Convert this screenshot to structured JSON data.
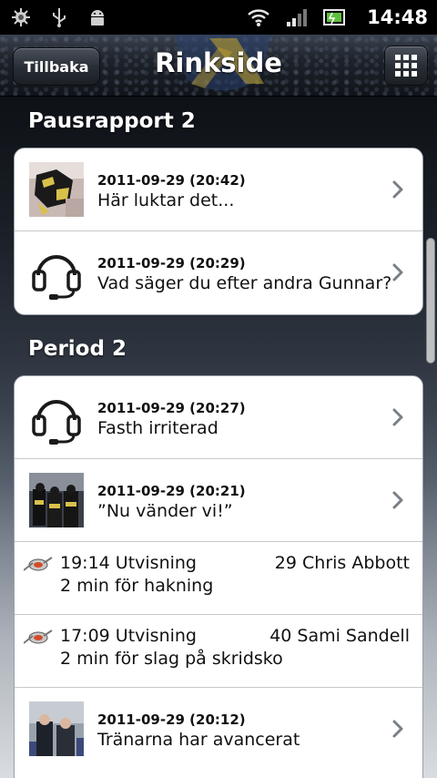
{
  "statusbar": {
    "time": "14:48",
    "icons": [
      "settings-chip-icon",
      "usb-icon",
      "android-icon",
      "wifi-icon",
      "signal-icon",
      "battery-icon"
    ]
  },
  "header": {
    "back_label": "Tillbaka",
    "title": "Rinkside",
    "menu_icon": "grid-icon"
  },
  "sections": [
    {
      "title": "Pausrapport 2",
      "items": [
        {
          "type": "photo",
          "date": "2011-09-29 (20:42)",
          "text": "Här luktar det..."
        },
        {
          "type": "audio",
          "date": "2011-09-29 (20:29)",
          "text": "Vad säger du efter andra Gunnar?"
        }
      ]
    },
    {
      "title": "Period 2",
      "items": [
        {
          "type": "audio",
          "date": "2011-09-29 (20:27)",
          "text": "Fasth irriterad"
        },
        {
          "type": "photo",
          "date": "2011-09-29 (20:21)",
          "text": "”Nu vänder vi!”"
        },
        {
          "type": "event",
          "time": "19:14 Utvisning",
          "player": "29 Chris Abbott",
          "detail": "2 min för hakning"
        },
        {
          "type": "event",
          "time": "17:09 Utvisning",
          "player": "40 Sami Sandell",
          "detail": "2 min för slag på skridsko"
        },
        {
          "type": "photo",
          "date": "2011-09-29 (20:12)",
          "text": "Tränarna har avancerat"
        }
      ]
    }
  ]
}
